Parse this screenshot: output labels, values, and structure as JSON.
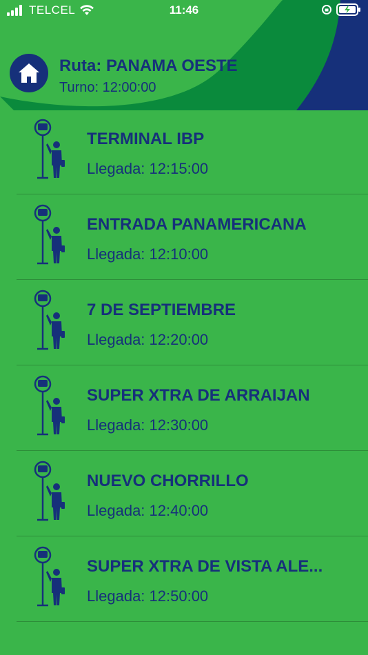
{
  "status_bar": {
    "carrier": "TELCEL",
    "time": "11:46"
  },
  "header": {
    "route_title": "Ruta: PANAMA OESTE",
    "shift": "Turno: 12:00:00",
    "colors": {
      "background_green": "#3ab54a",
      "dark_green": "#0a8a3c",
      "navy": "#16307a"
    }
  },
  "stops": [
    {
      "name": "TERMINAL IBP",
      "arrival": "Llegada: 12:15:00"
    },
    {
      "name": "ENTRADA PANAMERICANA",
      "arrival": "Llegada: 12:10:00"
    },
    {
      "name": "7 DE SEPTIEMBRE",
      "arrival": "Llegada: 12:20:00"
    },
    {
      "name": "SUPER XTRA DE ARRAIJAN",
      "arrival": "Llegada: 12:30:00"
    },
    {
      "name": "NUEVO CHORRILLO",
      "arrival": "Llegada: 12:40:00"
    },
    {
      "name": "SUPER XTRA DE VISTA ALE...",
      "arrival": "Llegada: 12:50:00"
    }
  ],
  "icons": {
    "home": "home-icon",
    "stop": "bus-stop-person-icon"
  }
}
